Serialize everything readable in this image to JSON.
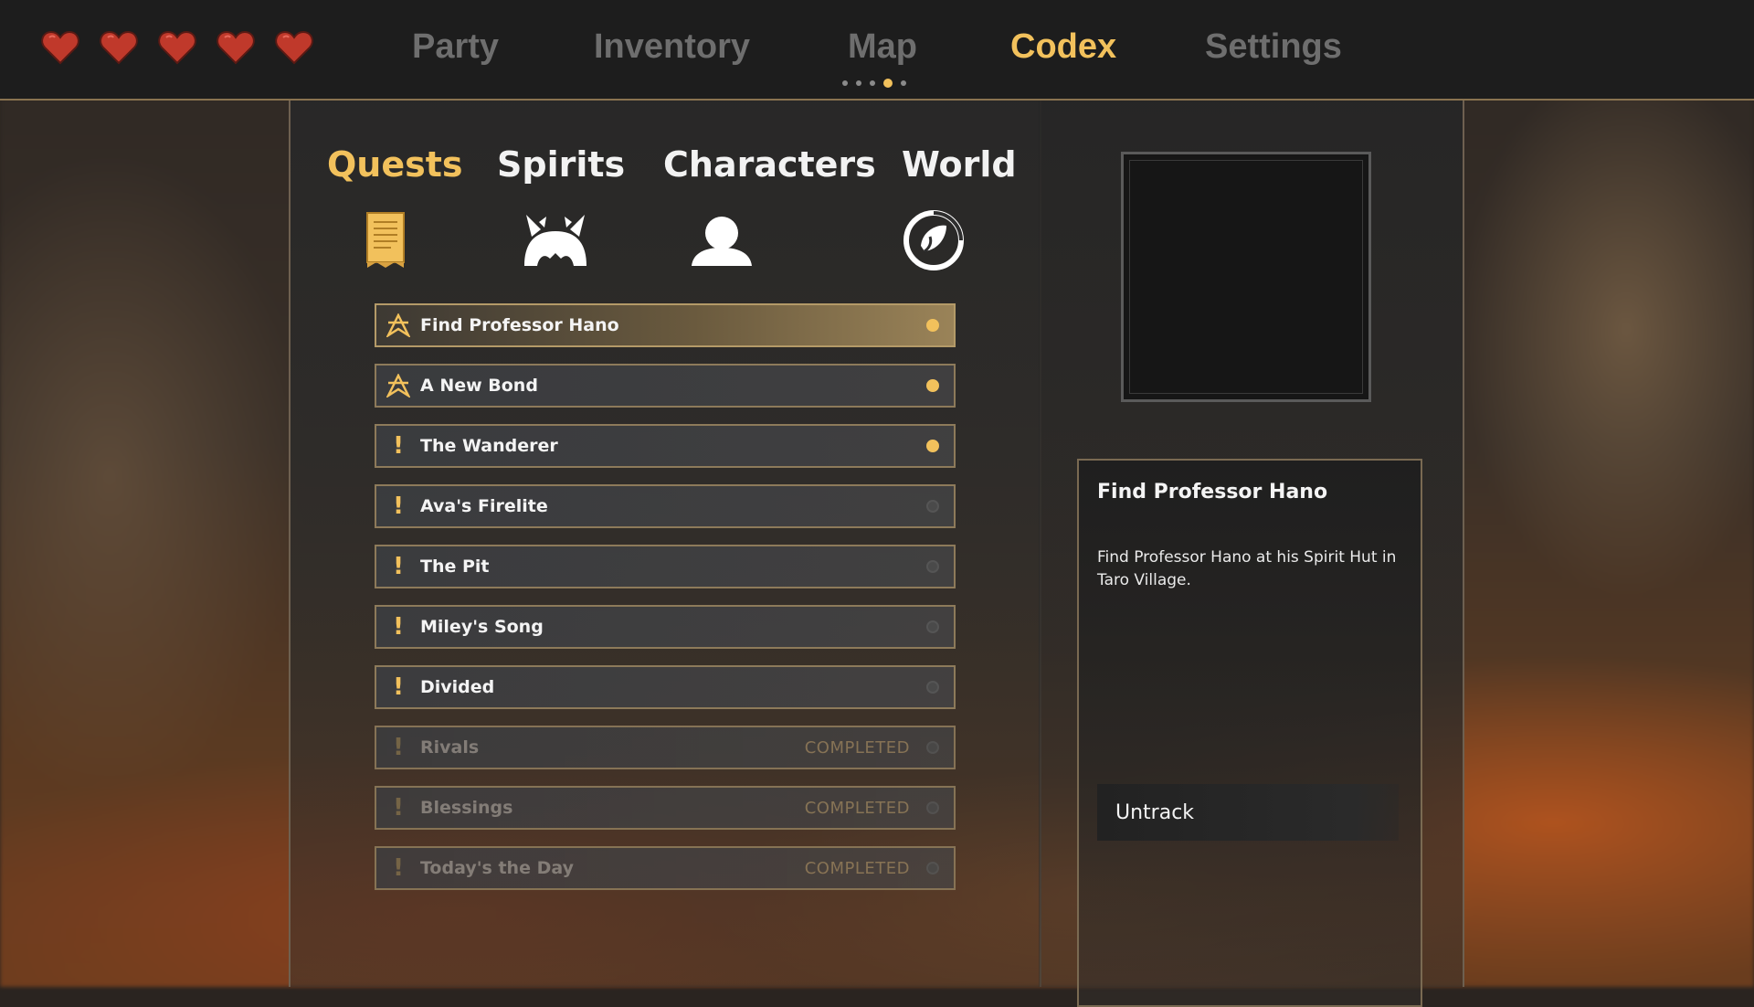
{
  "colors": {
    "accent": "#f2c15c",
    "nav_inactive": "#6e6e6e",
    "heart": "#c0392b"
  },
  "hud": {
    "hearts_count": 5
  },
  "nav": {
    "items": [
      {
        "label": "Party",
        "active": false
      },
      {
        "label": "Inventory",
        "active": false
      },
      {
        "label": "Map",
        "active": false
      },
      {
        "label": "Codex",
        "active": true
      },
      {
        "label": "Settings",
        "active": false
      }
    ]
  },
  "codex": {
    "tabs": [
      {
        "label": "Quests",
        "icon": "scroll-icon",
        "active": true
      },
      {
        "label": "Spirits",
        "icon": "spirit-icon",
        "active": false
      },
      {
        "label": "Characters",
        "icon": "person-icon",
        "active": false
      },
      {
        "label": "World",
        "icon": "world-emblem-icon",
        "active": false
      }
    ],
    "quests": [
      {
        "name": "Find Professor Hano",
        "icon": "main-quest-icon",
        "status": "",
        "tracked": true,
        "selected": true
      },
      {
        "name": "A New Bond",
        "icon": "main-quest-icon",
        "status": "",
        "tracked": true,
        "selected": false
      },
      {
        "name": "The Wanderer",
        "icon": "exclamation-icon",
        "status": "",
        "tracked": true,
        "selected": false
      },
      {
        "name": "Ava's Firelite",
        "icon": "exclamation-icon",
        "status": "",
        "tracked": false,
        "selected": false
      },
      {
        "name": "The Pit",
        "icon": "exclamation-icon",
        "status": "",
        "tracked": false,
        "selected": false
      },
      {
        "name": "Miley's Song",
        "icon": "exclamation-icon",
        "status": "",
        "tracked": false,
        "selected": false
      },
      {
        "name": "Divided",
        "icon": "exclamation-icon",
        "status": "",
        "tracked": false,
        "selected": false
      },
      {
        "name": "Rivals",
        "icon": "exclamation-icon",
        "status": "COMPLETED",
        "tracked": false,
        "selected": false
      },
      {
        "name": "Blessings",
        "icon": "exclamation-icon",
        "status": "COMPLETED",
        "tracked": false,
        "selected": false
      },
      {
        "name": "Today's the Day",
        "icon": "exclamation-icon",
        "status": "COMPLETED",
        "tracked": false,
        "selected": false
      }
    ]
  },
  "detail": {
    "title": "Find Professor Hano",
    "description": "Find Professor Hano at his Spirit Hut in Taro Village.",
    "untrack_label": "Untrack"
  }
}
